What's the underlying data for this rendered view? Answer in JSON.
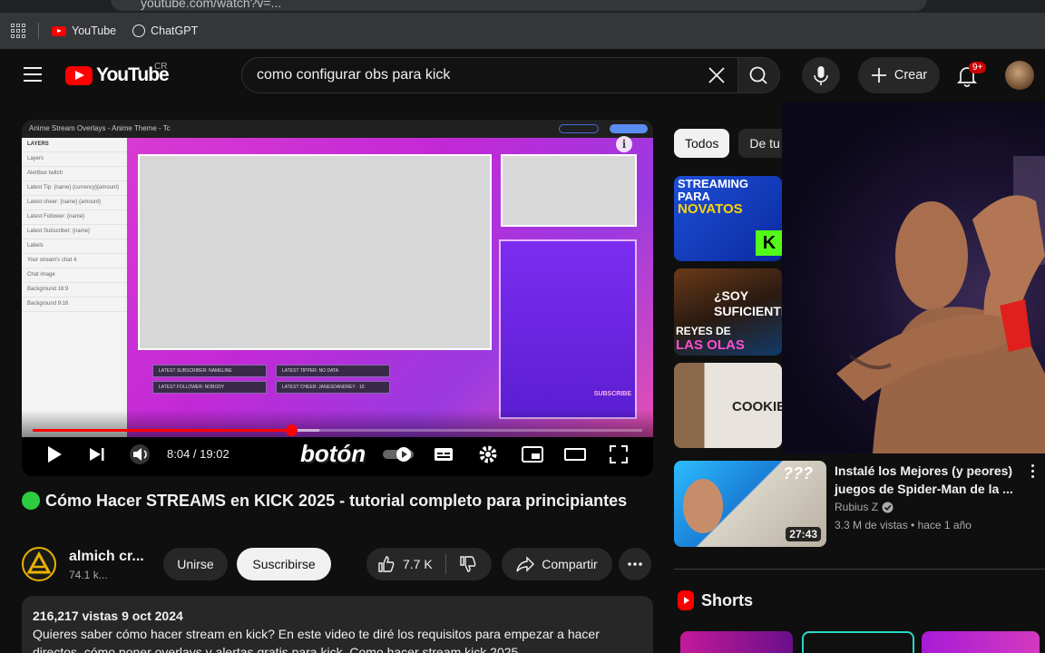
{
  "browser": {
    "url": "youtube.com/watch?v=...",
    "bookmarks": [
      {
        "label": "YouTube",
        "icon": "youtube-icon"
      },
      {
        "label": "ChatGPT",
        "icon": "chatgpt-icon"
      }
    ]
  },
  "masthead": {
    "logo_text": "YouTube",
    "country": "CR",
    "search_value": "como configurar obs para kick",
    "create_label": "Crear",
    "notifications_badge": "9+"
  },
  "player": {
    "editor_title": "Anime Stream Overlays - Anime Theme - Tc",
    "layers_header": "LAYERS",
    "layers": [
      "Layers",
      "Alertbox twitch",
      "Latest Tip: {name} {currency}{amount}",
      "Latest cheer: {name} {amount}",
      "Latest Follower: {name}",
      "Latest Subscriber: {name}",
      "Labels",
      "Your stream's chat 4",
      "Chat image",
      "Background 16:9",
      "Background 9:16"
    ],
    "alert_labels": [
      "LATEST SUBSCRIBER: NAMELINE",
      "LATEST TIPPER: NO DATA",
      "LATEST FOLLOWER: NOBODY",
      "LATEST CHEER: JANESDANDREY · 10"
    ],
    "subscribe_badge": "SUBSCRIBE",
    "current_time": "8:04",
    "duration": "19:02",
    "time_display": "8:04 / 19:02",
    "progress_fraction": 0.424,
    "buffer_fraction": 0.47,
    "caption_overlay": "botón"
  },
  "video": {
    "title": "Cómo Hacer STREAMS en KICK 2025 - tutorial completo para principiantes",
    "channel_name": "almich cr...",
    "channel_subs": "74.1 k...",
    "join_label": "Unirse",
    "subscribe_label": "Suscribirse",
    "likes": "7.7 K",
    "share_label": "Compartir",
    "views_date": "216,217 vistas  9 oct 2024",
    "description": "Quieres saber cómo hacer stream en kick? En este video te diré los requisitos para empezar a hacer directos, cómo poner overlays y alertas gratis para kick. Como hacer stream kick 2025"
  },
  "sidebar": {
    "chips": [
      "Todos",
      "De tu"
    ],
    "thumbs": [
      {
        "text1": "STREAMING PARA",
        "text2": "NOVATOS",
        "letter": "K"
      },
      {
        "text1": "¿SOY SUFICIENTE",
        "text2": "REYES DE",
        "text3": "LAS OLAS"
      },
      {
        "text1": "COOKIE"
      }
    ],
    "related": {
      "title": "Instalé los Mejores (y peores) juegos de Spider-Man de la ...",
      "channel": "Rubius Z",
      "meta": "3.3 M de vistas • hace 1 año",
      "duration": "27:43"
    },
    "shorts_label": "Shorts"
  },
  "colors": {
    "background": "#0f0f0f",
    "accent_red": "#ff0000",
    "overlay_pink": "#d83ad2",
    "overlay_purple": "#7c2df0"
  }
}
